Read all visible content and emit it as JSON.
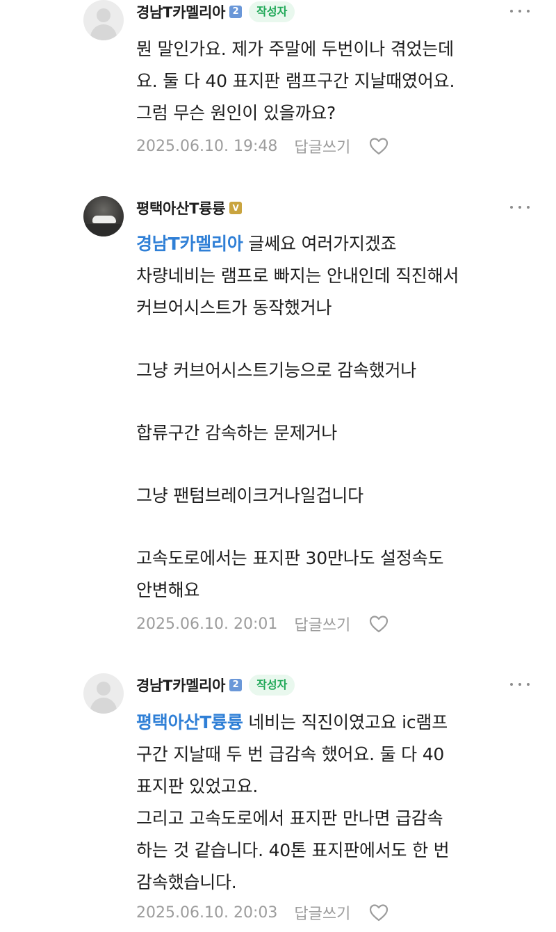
{
  "comments": [
    {
      "author": "경남T카멜리아",
      "level_badge": "2",
      "author_badge": "작성자",
      "mention": "",
      "lines": [
        "뭔 말인가요. 제가 주말에 두번이나 겪었는데",
        "요. 둘 다 40 표지판 램프구간 지날때였어요.",
        "그럼 무슨 원인이 있을까요?"
      ],
      "timestamp": "2025.06.10. 19:48",
      "reply_label": "답글쓰기"
    },
    {
      "author": "평택아산T륭륭",
      "level_badge": "V",
      "author_badge": "",
      "mention": "경남T카멜리아",
      "first_line_rest": " 글쎄요 여러가지겠죠",
      "lines": [
        "차량네비는 램프로 빠지는 안내인데 직진해서",
        "커브어시스트가 동작했거나",
        "",
        "그냥 커브어시스트기능으로 감속했거나",
        "",
        "합류구간 감속하는 문제거나",
        "",
        "그냥 팬텀브레이크거나일겁니다",
        "",
        "고속도로에서는 표지판 30만나도 설정속도",
        "안변해요"
      ],
      "timestamp": "2025.06.10. 20:01",
      "reply_label": "답글쓰기"
    },
    {
      "author": "경남T카멜리아",
      "level_badge": "2",
      "author_badge": "작성자",
      "mention": "평택아산T륭륭",
      "first_line_rest": " 네비는 직진이였고요 ic램프",
      "lines": [
        "구간 지날때 두 번 급감속 했어요. 둘 다 40",
        "표지판 있었고요.",
        "그리고 고속도로에서 표지판 만나면 급감속",
        "하는 것 같습니다. 40톤 표지판에서도 한 번",
        "감속했습니다."
      ],
      "timestamp": "2025.06.10. 20:03",
      "reply_label": "답글쓰기"
    }
  ],
  "colors": {
    "mention": "#2f7fd6",
    "author_badge_bg": "#e9f8ee",
    "author_badge_text": "#1fa857",
    "meta": "#9c9c9c",
    "level_blue": "#6a97d8",
    "level_gold": "#c9a43f"
  },
  "icons": {
    "more": "more-dots-icon",
    "like": "heart-outline-icon",
    "default_avatar": "default-profile-icon"
  }
}
